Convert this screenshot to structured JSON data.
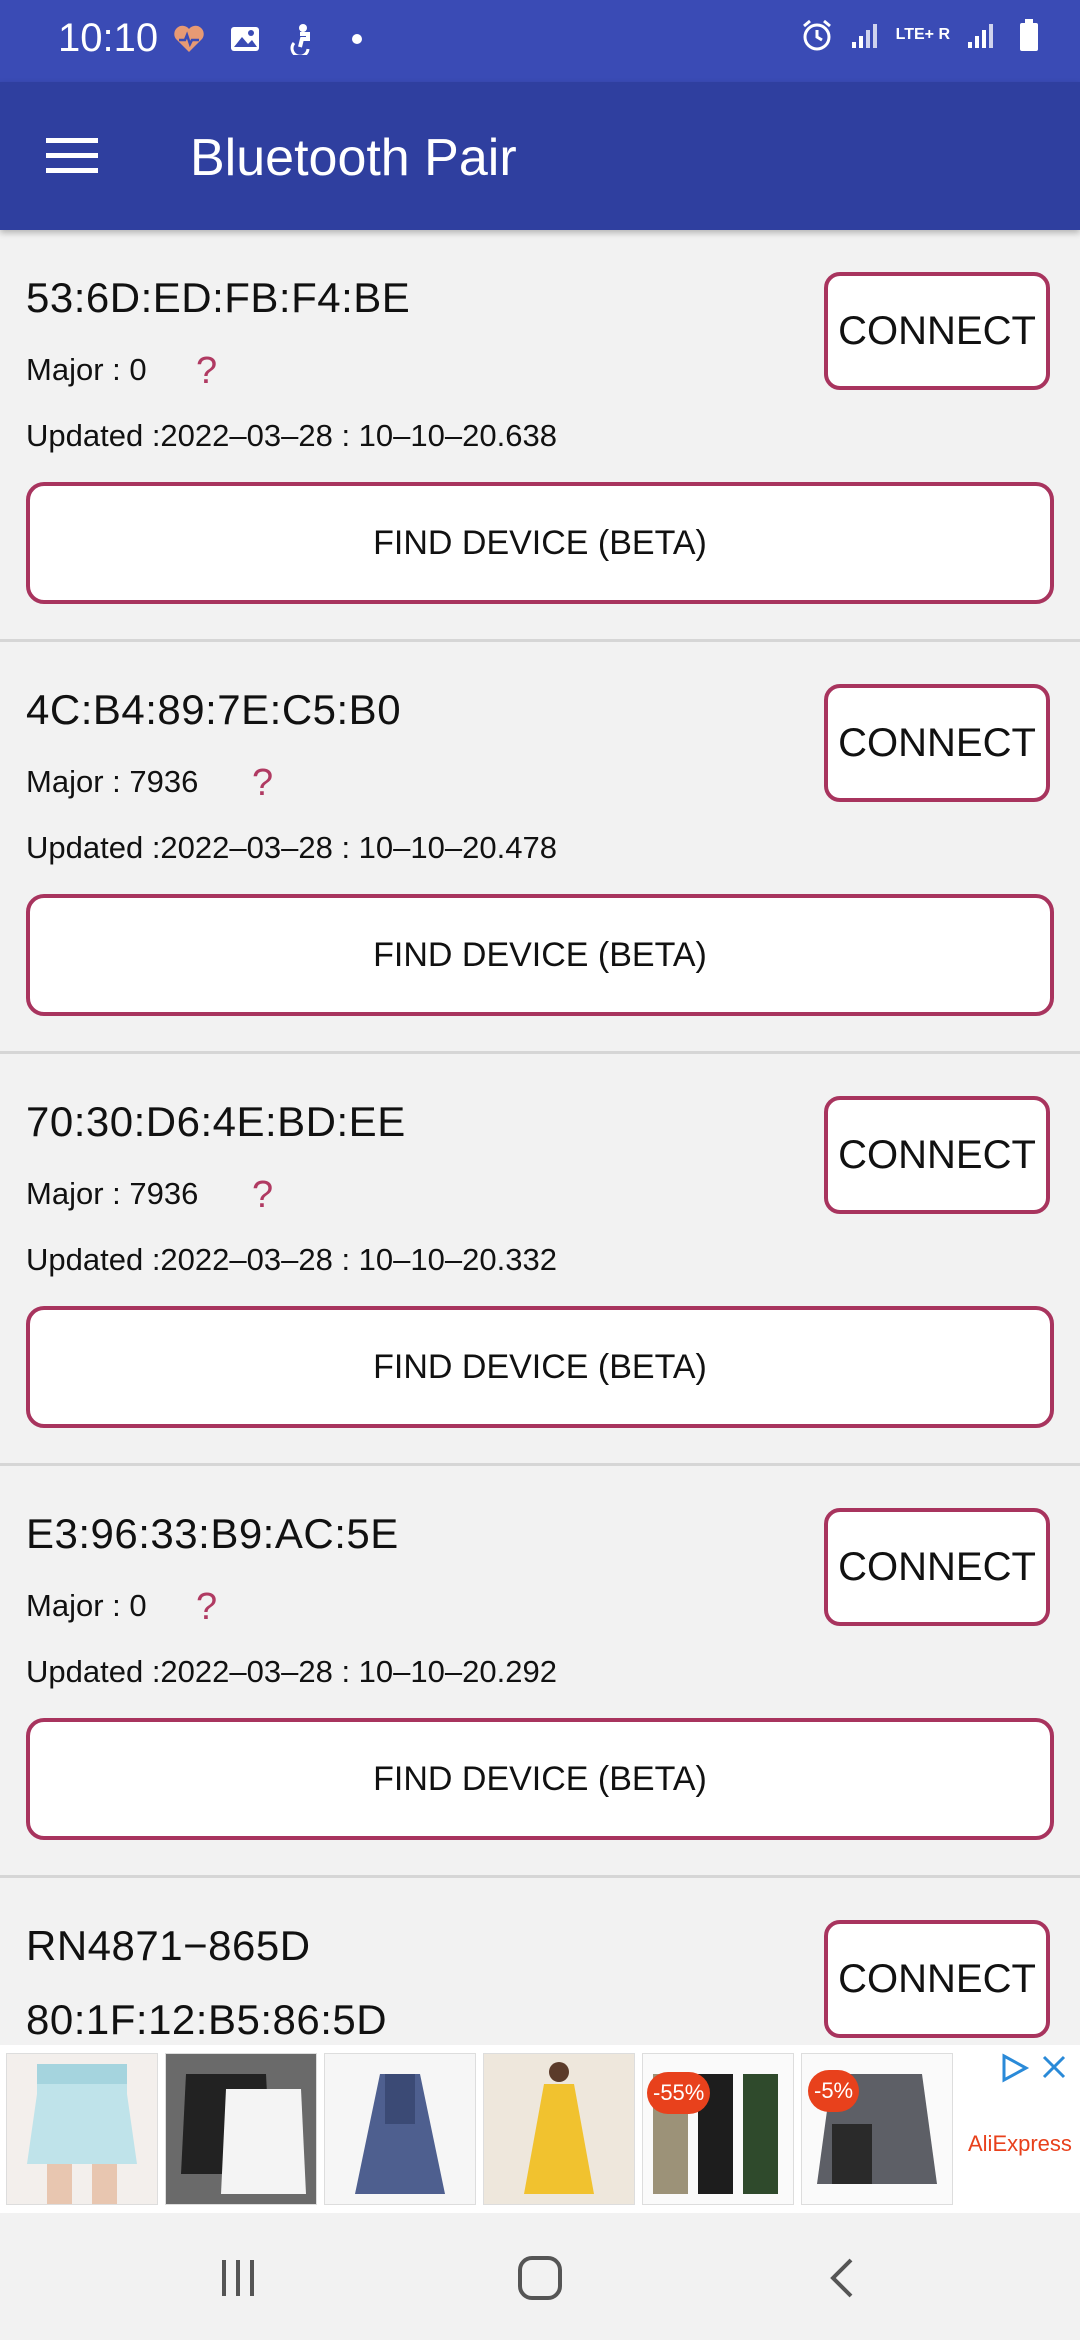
{
  "status_bar": {
    "time": "10:10",
    "left_icons": [
      "heart-monitor-icon",
      "gallery-icon",
      "accessibility-icon",
      "dot-icon"
    ],
    "lte_label": "LTE+ R",
    "right_icons": [
      "alarm-icon",
      "signal-icon",
      "signal-lte-icon",
      "battery-icon"
    ]
  },
  "app_bar": {
    "title": "Bluetooth Pair",
    "menu_icon": "hamburger-menu-icon"
  },
  "devices": [
    {
      "name": "53:6D:ED:FB:F4:BE",
      "major": "Major : 0",
      "updated": "Updated :2022–03–28 : 10–10–20.638",
      "connect_label": "CONNECT",
      "find_label": "FIND DEVICE (BETA)"
    },
    {
      "name": "4C:B4:89:7E:C5:B0",
      "major": "Major : 7936",
      "updated": "Updated :2022–03–28 : 10–10–20.478",
      "connect_label": "CONNECT",
      "find_label": "FIND DEVICE (BETA)"
    },
    {
      "name": "70:30:D6:4E:BD:EE",
      "major": "Major : 7936",
      "updated": "Updated :2022–03–28 : 10–10–20.332",
      "connect_label": "CONNECT",
      "find_label": "FIND DEVICE (BETA)"
    },
    {
      "name": "E3:96:33:B9:AC:5E",
      "major": "Major : 0",
      "updated": "Updated :2022–03–28 : 10–10–20.292",
      "connect_label": "CONNECT",
      "find_label": "FIND DEVICE (BETA)"
    },
    {
      "name": "RN4871−865D",
      "address": "80:1F:12:B5:86:5D",
      "connect_label": "CONNECT"
    }
  ],
  "help_glyph": "?",
  "ad": {
    "badges": [
      "-55%",
      "-5%"
    ],
    "brand": "AliExpress",
    "icons": [
      "adchoices-icon",
      "close-icon"
    ]
  },
  "nav_bar": {
    "icons": [
      "recent-apps-icon",
      "home-icon",
      "back-icon"
    ]
  },
  "colors": {
    "status_bar": "#3a4bb5",
    "app_bar": "#2f3f9f",
    "accent_border": "#a8345e",
    "background": "#f2f2f2"
  }
}
